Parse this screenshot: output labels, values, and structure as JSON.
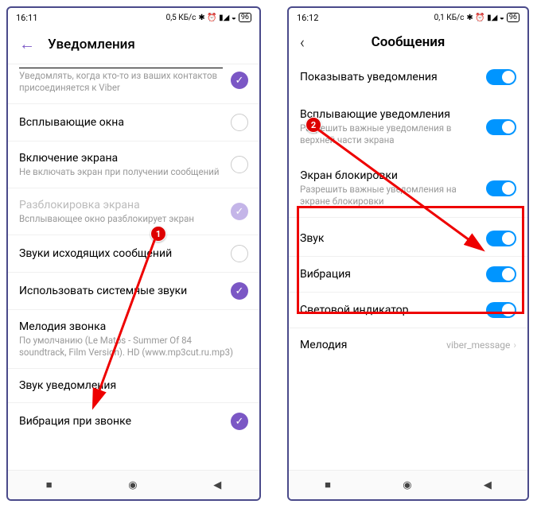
{
  "left": {
    "status": {
      "time": "16:11",
      "net": "0,5 КБ/с",
      "batt": "96"
    },
    "title": "Уведомления",
    "rows": [
      {
        "title": "",
        "sub": "Уведомлять, когда кто-то из ваших контактов присоединяется к Viber",
        "ctrl": "checked"
      },
      {
        "title": "Всплывающие окна",
        "ctrl": "empty"
      },
      {
        "title": "Включение экрана",
        "sub": "Не включать экран при получении сообщений",
        "ctrl": "empty"
      },
      {
        "title": "Разблокировка экрана",
        "sub": "Всплывающее окно разблокирует экран",
        "ctrl": "checked-light",
        "disabled": true
      },
      {
        "title": "Звуки исходящих сообщений",
        "ctrl": "empty"
      },
      {
        "title": "Использовать системные звуки",
        "ctrl": "checked"
      },
      {
        "title": "Мелодия звонка",
        "sub": "По умолчанию (Le Matos - Summer Of 84 soundtrack, Film Version). HD (www.mp3cut.ru.mp3)"
      },
      {
        "title": "Звук уведомления"
      },
      {
        "title": "Вибрация при звонке",
        "ctrl": "checked"
      }
    ]
  },
  "right": {
    "status": {
      "time": "16:12",
      "net": "0,1 КБ/с",
      "batt": "96"
    },
    "title": "Сообщения",
    "rows": [
      {
        "title": "Показывать уведомления"
      },
      {
        "title": "Всплывающие уведомления",
        "sub": "Разрешить важные уведомления в верхней части экрана"
      },
      {
        "title": "Экран блокировки",
        "sub": "Разрешить важные уведомления на экране блокировки"
      },
      {
        "title": "Звук"
      },
      {
        "title": "Вибрация"
      },
      {
        "title": "Световой индикатор"
      },
      {
        "title": "Мелодия",
        "value": "viber_message"
      }
    ]
  },
  "markers": {
    "m1": "1",
    "m2": "2"
  }
}
